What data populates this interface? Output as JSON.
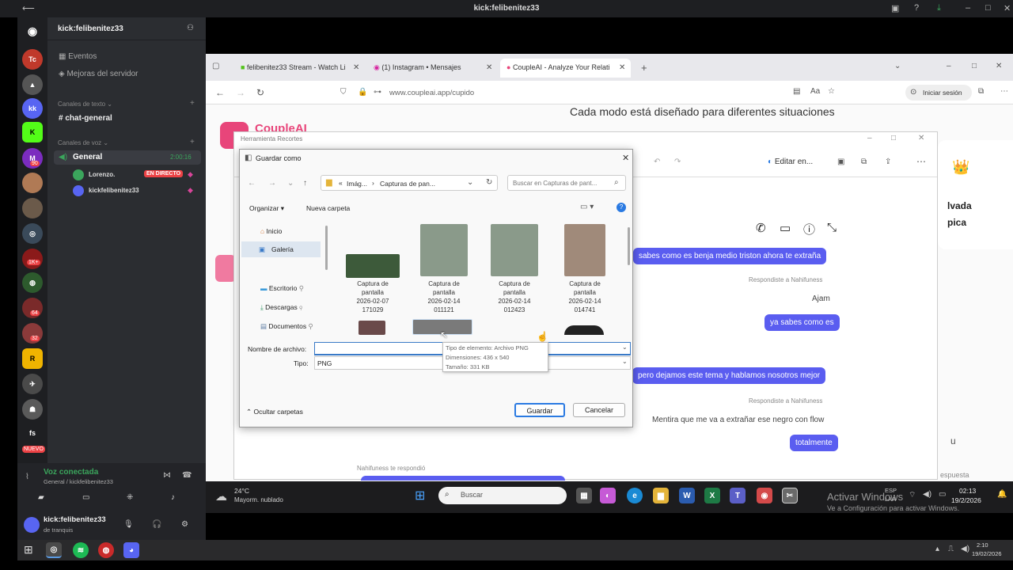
{
  "titlebar": {
    "title": "kick:felibenitez33"
  },
  "discord": {
    "server_name": "kick:felibenitez33",
    "events": "Eventos",
    "boost": "Mejoras del servidor",
    "text_channels_header": "Canales de texto",
    "text_channel": "chat-general",
    "voice_channels_header": "Canales de voz",
    "voice_channel": "General",
    "voice_timer": "2:00:16",
    "voice_users": [
      {
        "name": "Lorenzo.",
        "badge": "EN DIRECTO"
      },
      {
        "name": "kickfelibenitez33",
        "badge": ""
      }
    ],
    "server_labels": {
      "fs": "fs",
      "nuevo": "NUEVO",
      "badge_90": "90",
      "badge_1k": "1K+",
      "badge_64": "64",
      "badge_32": "32"
    },
    "voice_connected": "Voz conectada",
    "voice_connected_sub": "General / kickfelibenitez33",
    "user_name": "kick:felibenitez33",
    "user_status": "de tranquis"
  },
  "browser": {
    "tabs": [
      {
        "label": "felibenitez33 Stream - Watch Li",
        "icon": "kick-icon"
      },
      {
        "label": "(1) Instagram • Mensajes",
        "icon": "instagram-icon"
      },
      {
        "label": "CoupleAI - Analyze Your Relati",
        "icon": "coupleai-icon"
      }
    ],
    "url": "www.coupleai.app/cupido",
    "signin": "Iniciar sesión"
  },
  "page": {
    "heading": "Cada modo está diseñado para diferentes situaciones",
    "logo": "CoupleAI",
    "card_text_1": "lvada",
    "card_text_2": "pica"
  },
  "snip": {
    "title": "Herramienta Recortes",
    "edit": "Editar en...",
    "messages": [
      {
        "type": "sent",
        "text": "sabes como es benja medio triston ahora te extraña"
      },
      {
        "type": "meta",
        "text": "Respondiste a Nahifuness"
      },
      {
        "type": "recv",
        "text": "Ajam"
      },
      {
        "type": "sent",
        "text": "ya sabes como es"
      },
      {
        "type": "sent",
        "text": "pero dejamos este tema y hablamos nosotros mejor"
      },
      {
        "type": "meta",
        "text": "Respondiste a Nahifuness"
      },
      {
        "type": "recv",
        "text": "Mentira que me va a extrañar ese negro con flow"
      },
      {
        "type": "sent",
        "text": "totalmente"
      },
      {
        "type": "meta",
        "text": "Nahifuness te respondió"
      }
    ],
    "right_u": "u",
    "right_respuesta": "espuesta"
  },
  "dialog": {
    "title": "Guardar como",
    "breadcrumb": [
      "Imág...",
      "Capturas de pan..."
    ],
    "search_placeholder": "Buscar en Capturas de pant...",
    "organize": "Organizar",
    "new_folder": "Nueva carpeta",
    "nav": [
      "Inicio",
      "Galería",
      "Escritorio",
      "Descargas",
      "Documentos"
    ],
    "files": [
      {
        "name": "Captura de pantalla 2026-02-07 171029",
        "color": "#3d5a3a"
      },
      {
        "name": "Captura de pantalla 2026-02-14 011121",
        "color": "#7b8a7a"
      },
      {
        "name": "Captura de pantalla 2026-02-14 012423",
        "color": "#7b8a7a"
      },
      {
        "name": "Captura de pantalla 2026-02-14 014741",
        "color": "#9a8070"
      }
    ],
    "filename_label": "Nombre de archivo:",
    "filename_value": "",
    "type_label": "Tipo:",
    "type_value": "PNG",
    "tooltip": [
      "Tipo de elemento: Archivo PNG",
      "Dimensiones: 436 x 540",
      "Tamaño: 331 KB"
    ],
    "hide_folders": "Ocultar carpetas",
    "save": "Guardar",
    "cancel": "Cancelar"
  },
  "taskbar": {
    "temp": "24°C",
    "weather": "Mayorm. nublado",
    "search": "Buscar",
    "activate_title": "Activar Windows",
    "activate_sub": "Ve a Configuración para activar Windows.",
    "lang": "ESP",
    "lang2": "LAA",
    "time": "02:13",
    "date": "19/2/2026"
  },
  "wintaskbar": {
    "time": "2:10",
    "date": "19/02/2026"
  }
}
